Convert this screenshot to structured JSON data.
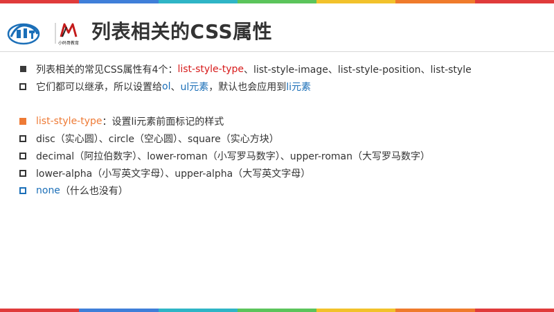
{
  "colors": {
    "stripe": [
      "#e03b3b",
      "#3f7fd9",
      "#2fb5c6",
      "#5bc45b",
      "#f2c22b",
      "#ef7b2c",
      "#e03b3b"
    ],
    "text": "#333333",
    "red": "#d71a1a",
    "blue": "#1b6fb8",
    "orange": "#ee7a35"
  },
  "header": {
    "title": "列表相关的CSS属性",
    "logo_icons": [
      "brand-logo-icon",
      "mashibing-logo-icon"
    ],
    "logo_brand_text": "小码哥教育"
  },
  "lines": [
    {
      "bullet": "sq-filled",
      "segments": [
        {
          "text": "列表相关的常见CSS属性有4个：",
          "color": "#333333"
        },
        {
          "text": "list-style-type",
          "color": "#d71a1a"
        },
        {
          "text": "、list-style-image、list-style-position、list-style",
          "color": "#333333"
        }
      ]
    },
    {
      "bullet": "sq-hollow",
      "segments": [
        {
          "text": "它们都可以继承，所以设置给",
          "color": "#333333"
        },
        {
          "text": "ol",
          "color": "#1b6fb8"
        },
        {
          "text": "、",
          "color": "#333333"
        },
        {
          "text": "ul元素",
          "color": "#1b6fb8"
        },
        {
          "text": "，默认也会应用到",
          "color": "#333333"
        },
        {
          "text": "li元素",
          "color": "#1b6fb8"
        }
      ]
    },
    {
      "bullet": "none",
      "segments": []
    },
    {
      "bullet": "sq-orange",
      "segments": [
        {
          "text": "list-style-type",
          "color": "#ee7a35"
        },
        {
          "text": "：设置li元素前面标记的样式",
          "color": "#333333"
        }
      ]
    },
    {
      "bullet": "sq-hollow",
      "segments": [
        {
          "text": "disc（实心圆）、circle（空心圆）、square（实心方块）",
          "color": "#333333"
        }
      ]
    },
    {
      "bullet": "sq-hollow",
      "segments": [
        {
          "text": "decimal（阿拉伯数字）、lower-roman（小写罗马数字）、upper-roman（大写罗马数字）",
          "color": "#333333"
        }
      ]
    },
    {
      "bullet": "sq-hollow",
      "segments": [
        {
          "text": "lower-alpha（小写英文字母）、upper-alpha（大写英文字母）",
          "color": "#333333"
        }
      ]
    },
    {
      "bullet": "sq-blue",
      "segments": [
        {
          "text": "none",
          "color": "#1b6fb8"
        },
        {
          "text": "（什么也没有）",
          "color": "#333333"
        }
      ]
    }
  ]
}
